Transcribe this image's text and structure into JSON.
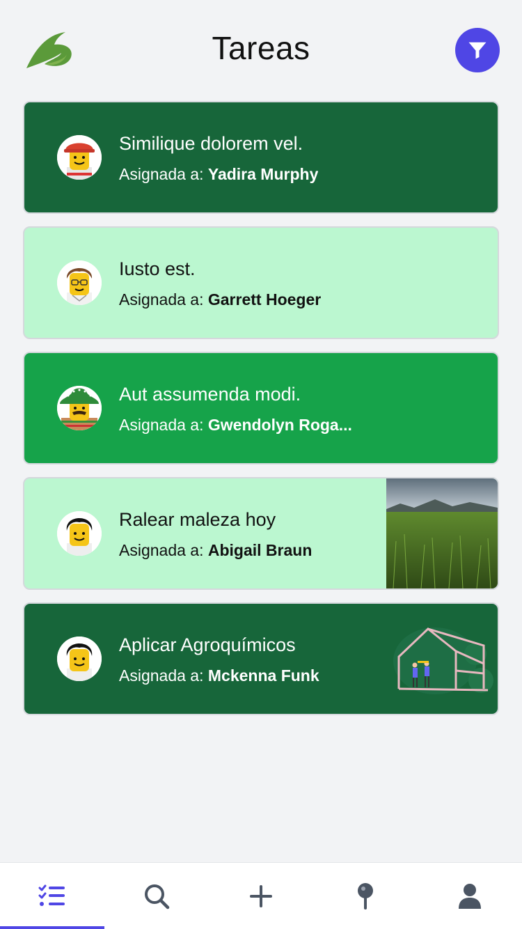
{
  "header": {
    "title": "Tareas",
    "logo_icon": "leaf-b-logo",
    "filter_icon": "filter-icon",
    "accent": "#4f46e5"
  },
  "tasks": [
    {
      "title": "Similique dolorem vel.",
      "assigned_label": "Asignada a:",
      "assignee": "Yadira Murphy",
      "style": "dark",
      "avatar_icon": "avatar-red-helmet"
    },
    {
      "title": "Iusto est.",
      "assigned_label": "Asignada a:",
      "assignee": "Garrett Hoeger",
      "style": "light",
      "avatar_icon": "avatar-brown-hair-glasses"
    },
    {
      "title": "Aut assumenda modi.",
      "assigned_label": "Asignada a:",
      "assignee": "Gwendolyn Roga...",
      "style": "mid",
      "avatar_icon": "avatar-sombrero"
    },
    {
      "title": "Ralear maleza hoy",
      "assigned_label": "Asignada a:",
      "assignee": "Abigail Braun",
      "style": "light",
      "avatar_icon": "avatar-black-hair",
      "image": "grass-field-photo"
    },
    {
      "title": "Aplicar Agroquímicos",
      "assigned_label": "Asignada a:",
      "assignee": "Mckenna Funk",
      "style": "dark",
      "avatar_icon": "avatar-black-hair",
      "image": "greenhouse-illustration"
    }
  ],
  "colors": {
    "dark_green": "#17663a",
    "light_green": "#bbf7d0",
    "mid_green": "#16a34a"
  },
  "tabbar": {
    "items": [
      {
        "icon": "task-list-icon",
        "active": true
      },
      {
        "icon": "search-icon",
        "active": false
      },
      {
        "icon": "plus-icon",
        "active": false
      },
      {
        "icon": "pin-icon",
        "active": false
      },
      {
        "icon": "user-icon",
        "active": false
      }
    ]
  }
}
